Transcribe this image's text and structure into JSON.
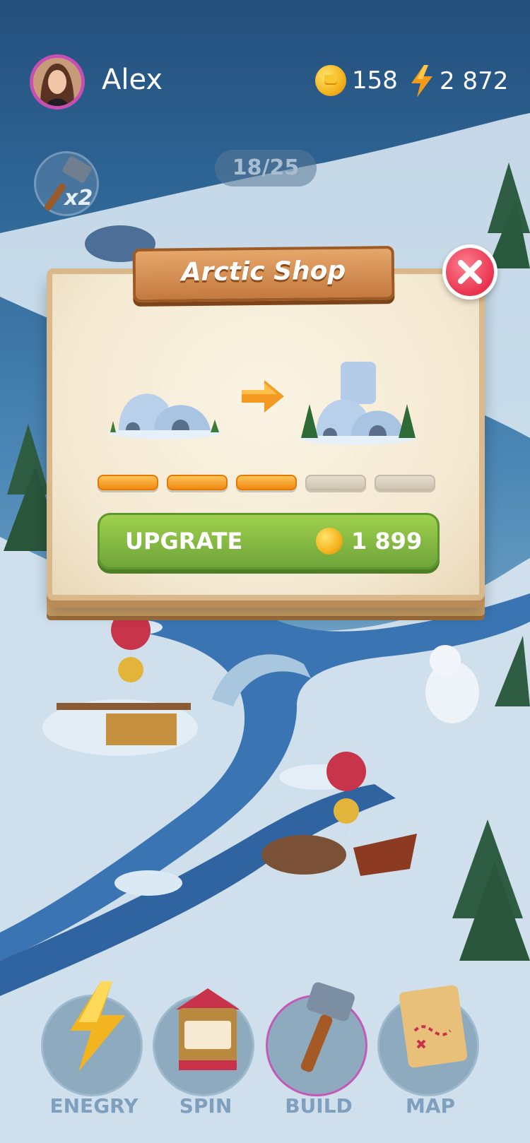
{
  "user": {
    "name": "Alex"
  },
  "stats": {
    "coins": "158",
    "energy": "2 872"
  },
  "tools": {
    "hammer_count": "x2"
  },
  "level_progress": "18/25",
  "dialog": {
    "title": "Arctic Shop",
    "upgrade_label": "UPGRATE",
    "upgrade_price": "1 899",
    "levels": {
      "filled": 3,
      "total": 5
    }
  },
  "nav": [
    {
      "label": "ENEGRY",
      "icon": "energy-bolt-icon"
    },
    {
      "label": "SPIN",
      "icon": "slot-machine-icon"
    },
    {
      "label": "BUILD",
      "icon": "hammer-icon"
    },
    {
      "label": "MAP",
      "icon": "treasure-map-icon"
    }
  ],
  "colors": {
    "accent_pink": "#c74fb3",
    "button_green": "#7fb43f",
    "level_orange": "#f5a623",
    "close_red": "#e8334e"
  }
}
